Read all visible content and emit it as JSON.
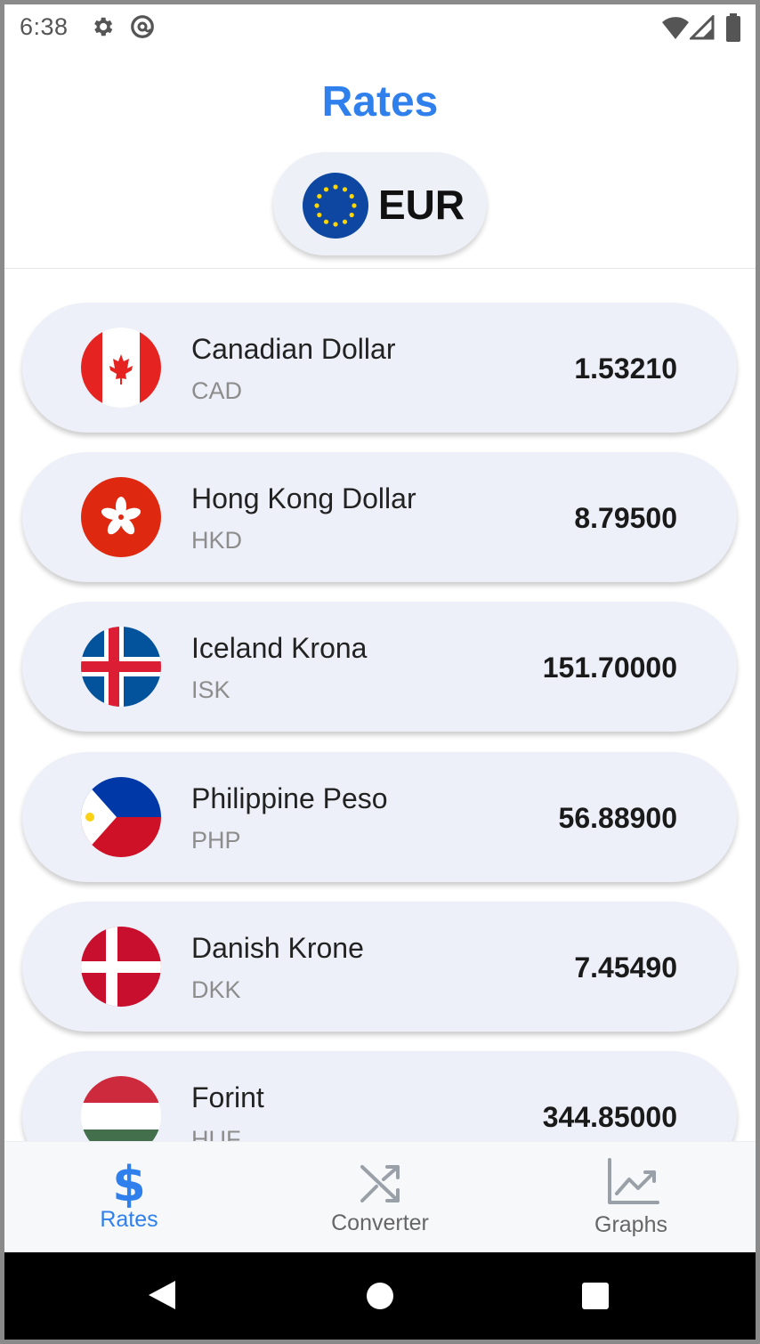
{
  "status_bar": {
    "time": "6:38",
    "icons": [
      "gear-icon",
      "at-sign-icon",
      "wifi-icon",
      "signal-icon",
      "battery-icon"
    ]
  },
  "header": {
    "title": "Rates",
    "base_currency": {
      "code": "EUR",
      "flag": "eu-flag-icon"
    }
  },
  "rates": [
    {
      "name": "Canadian Dollar",
      "code": "CAD",
      "value": "1.53210",
      "flag": "canada-flag-icon"
    },
    {
      "name": "Hong Kong Dollar",
      "code": "HKD",
      "value": "8.79500",
      "flag": "hong-kong-flag-icon"
    },
    {
      "name": "Iceland Krona",
      "code": "ISK",
      "value": "151.70000",
      "flag": "iceland-flag-icon"
    },
    {
      "name": "Philippine Peso",
      "code": "PHP",
      "value": "56.88900",
      "flag": "philippines-flag-icon"
    },
    {
      "name": "Danish Krone",
      "code": "DKK",
      "value": "7.45490",
      "flag": "denmark-flag-icon"
    },
    {
      "name": "Forint",
      "code": "HUF",
      "value": "344.85000",
      "flag": "hungary-flag-icon"
    }
  ],
  "bottom_nav": {
    "items": [
      {
        "label": "Rates",
        "icon": "dollar-icon",
        "active": true
      },
      {
        "label": "Converter",
        "icon": "shuffle-icon",
        "active": false
      },
      {
        "label": "Graphs",
        "icon": "chart-icon",
        "active": false
      }
    ]
  },
  "colors": {
    "accent": "#2f80ed",
    "card_background": "#edf0f8",
    "inactive_nav": "#888888"
  }
}
